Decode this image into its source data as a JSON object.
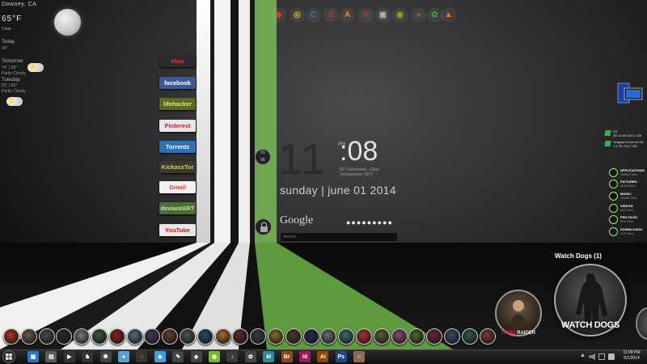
{
  "weather": {
    "location": "Downey, CA",
    "temperature": "65°F",
    "condition": "Clear",
    "today_label": "Today",
    "today_temp": "65°",
    "tomorrow_label": "Tomorrow",
    "tomorrow_temps": "74° | 59°",
    "tomorrow_condition": "Partly Cloudy",
    "tuesday_label": "Tuesday",
    "tuesday_temps": "81° | 60°",
    "tuesday_condition": "Partly Cloudy"
  },
  "web_links": [
    {
      "label": "ebay",
      "bg": "#2b2b2b",
      "fg": "#e53238"
    },
    {
      "label": "facebook",
      "bg": "#3b5998",
      "fg": "#ffffff"
    },
    {
      "label": "lifehacker",
      "bg": "#5a6b1a",
      "fg": "#d8e4a0"
    },
    {
      "label": "Pinterest",
      "bg": "#e7e7e7",
      "fg": "#cb2027"
    },
    {
      "label": "Torrentz",
      "bg": "#2e6fb8",
      "fg": "#ffffff"
    },
    {
      "label": "KickassTor",
      "bg": "#3a3a2a",
      "fg": "#d9c77a"
    },
    {
      "label": "Gmail",
      "bg": "#f1f1f1",
      "fg": "#d14836"
    },
    {
      "label": "deviantART",
      "bg": "#4e6b3a",
      "fg": "#c8e3a8"
    },
    {
      "label": "YouTube",
      "bg": "#e8e8e8",
      "fg": "#cc181e"
    }
  ],
  "top_icons": [
    {
      "name": "shield-icon",
      "glyph": "◆",
      "color": "#e03a2a"
    },
    {
      "name": "chrome-icon",
      "glyph": "◎",
      "color": "#f2b51e"
    },
    {
      "name": "ccleaner-icon",
      "glyph": "C",
      "color": "#2f7dd1"
    },
    {
      "name": "s-icon",
      "glyph": "S",
      "color": "#d83020"
    },
    {
      "name": "avast-icon",
      "glyph": "A",
      "color": "#f08a1c"
    },
    {
      "name": "v-icon",
      "glyph": "V",
      "color": "#d83020"
    },
    {
      "name": "media-icon",
      "glyph": "▣",
      "color": "#b0b0b0"
    },
    {
      "name": "nvidia-icon",
      "glyph": "◉",
      "color": "#76b900"
    },
    {
      "name": "football-icon",
      "glyph": "●",
      "color": "#9a5a2a"
    },
    {
      "name": "globe-icon",
      "glyph": "✿",
      "color": "#4aa040"
    },
    {
      "name": "vlc-icon",
      "glyph": "▲",
      "color": "#f47c20"
    }
  ],
  "clock": {
    "date_circle_top": "01",
    "date_circle_bottom": "06",
    "hour": "11",
    "ampm": "PM",
    "minute": "08",
    "weather_line_1": "65° Fahrenheit - Clear",
    "weather_line_2": "Temperature: 65°F",
    "date_line": "sunday | june 01 2014",
    "search_label": "Google",
    "password_dots": "●●●●●●●●●",
    "search_placeholder": "Search..."
  },
  "drives": [
    {
      "name": "OS",
      "info": "357.8 GB 300.1 GB"
    },
    {
      "name": "Seagate External HD",
      "info": "1.5 TB    218.7 GB"
    }
  ],
  "folders": [
    {
      "title": "APPLICATIONS:",
      "sub": "25504 Files"
    },
    {
      "title": "PICTURES:",
      "sub": "4046 Files"
    },
    {
      "title": "MUSIC:",
      "sub": "11466 Files"
    },
    {
      "title": "VIDEOS:",
      "sub": "441 Files"
    },
    {
      "title": "PSD FILES:",
      "sub": "503 Files"
    },
    {
      "title": "DOWNLOADS:",
      "sub": "222 Files"
    }
  ],
  "featured_game": {
    "title": "Watch Dogs (1)",
    "logo_text": "WATCH DOGS"
  },
  "tomb_raider": {
    "logo_prefix": "TOMB",
    "logo_suffix": "RAIDER"
  },
  "game_dock_colors": [
    "#a8342a",
    "#6a5a4a",
    "#4a4a4a",
    "#2a2a2a",
    "#7a7a7a",
    "#3a5a3a",
    "#8a2020",
    "#5a6a7a",
    "#3a3a5a",
    "#6a3a2a",
    "#4a5a4a",
    "#2a4a6a",
    "#aa6a2a",
    "#5a2a2a",
    "#3a3a3a",
    "#8a6a2a",
    "#4a3a2a",
    "#2a2a4a",
    "#6a6a6a",
    "#3a6a6a",
    "#b03030",
    "#5a5a3a",
    "#8a4a6a",
    "#4a6a2a",
    "#6a2a2a",
    "#3a4a5a",
    "#2a5a4a",
    "#7a3a3a"
  ],
  "taskbar": {
    "apps": [
      {
        "name": "media-center-app",
        "glyph": "▣",
        "bg": "#2a77c8"
      },
      {
        "name": "folder-app",
        "glyph": "▤",
        "bg": "#5a5a5a"
      },
      {
        "name": "media-player-app",
        "glyph": "▶",
        "bg": "#333"
      },
      {
        "name": "chess-app",
        "glyph": "♞",
        "bg": "#333"
      },
      {
        "name": "network-app",
        "glyph": "✺",
        "bg": "#444"
      },
      {
        "name": "ball-app",
        "glyph": "●",
        "bg": "#55a0d0"
      },
      {
        "name": "steam-app",
        "glyph": "◌",
        "bg": "#333"
      },
      {
        "name": "daemon-app",
        "glyph": "◆",
        "bg": "#3aa0e0"
      },
      {
        "name": "paint-app",
        "glyph": "✎",
        "bg": "#444"
      },
      {
        "name": "game-app",
        "glyph": "◈",
        "bg": "#444"
      },
      {
        "name": "spotify-app",
        "glyph": "◉",
        "bg": "#7ab82a"
      },
      {
        "name": "itunes-app",
        "glyph": "♪",
        "bg": "#3a3a3a"
      },
      {
        "name": "picasa-app",
        "glyph": "✿",
        "bg": "#444"
      },
      {
        "name": "maya-app",
        "glyph": "M",
        "bg": "#2a8aa0"
      },
      {
        "name": "bridge-app",
        "glyph": "Br",
        "bg": "#8a4a10"
      },
      {
        "name": "indesign-app",
        "glyph": "Id",
        "bg": "#a01a5a"
      },
      {
        "name": "illustrator-app",
        "glyph": "Ai",
        "bg": "#8a4a00"
      },
      {
        "name": "photoshop-app",
        "glyph": "Ps",
        "bg": "#1a4a8a"
      },
      {
        "name": "user-app",
        "glyph": "☺",
        "bg": "#8a6a50"
      }
    ],
    "show_hidden": "▲",
    "time": "11:08 PM",
    "date": "6/1/2014"
  }
}
